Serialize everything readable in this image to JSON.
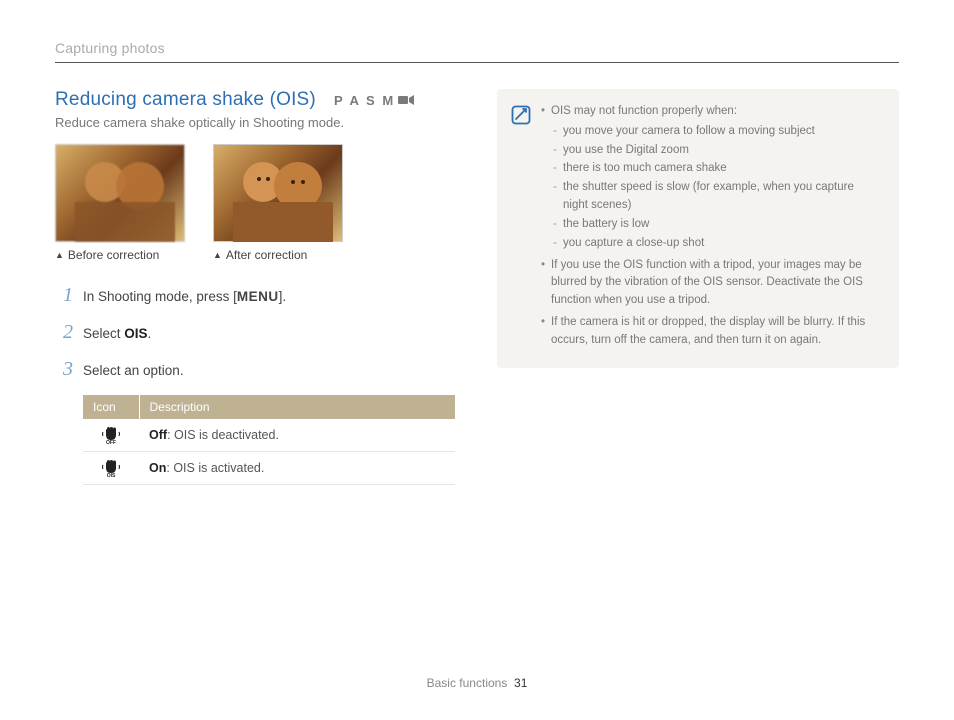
{
  "breadcrumb": "Capturing photos",
  "heading": "Reducing camera shake (OIS)",
  "mode_letters": "P A S M",
  "subtitle": "Reduce camera shake optically in Shooting mode.",
  "photo_captions": {
    "before": "Before correction",
    "after": "After correction"
  },
  "steps": {
    "s1": {
      "num": "1",
      "pre": "In Shooting mode, press [",
      "menu": "MENU",
      "post": "]."
    },
    "s2": {
      "num": "2",
      "pre": "Select ",
      "bold": "OIS",
      "post": "."
    },
    "s3": {
      "num": "3",
      "text": "Select an option."
    }
  },
  "table": {
    "headers": {
      "icon": "Icon",
      "desc": "Description"
    },
    "rows": [
      {
        "label": "Off",
        "sep": ": ",
        "rest": "OIS is deactivated."
      },
      {
        "label": "On",
        "sep": ": ",
        "rest": "OIS is activated."
      }
    ]
  },
  "notes": {
    "intro": "OIS may not function properly when:",
    "sub": [
      "you move your camera to follow a moving subject",
      "you use the Digital zoom",
      "there is too much camera shake",
      "the shutter speed is slow (for example, when you capture night scenes)",
      "the battery is low",
      "you capture a close-up shot"
    ],
    "b2": "If you use the OIS function with a tripod, your images may be blurred by the vibration of the OIS sensor. Deactivate the OIS function when you use a tripod.",
    "b3": "If the camera is hit or dropped, the display will be blurry. If this occurs, turn off the camera, and then turn it on again."
  },
  "footer": {
    "section": "Basic functions",
    "page": "31"
  }
}
